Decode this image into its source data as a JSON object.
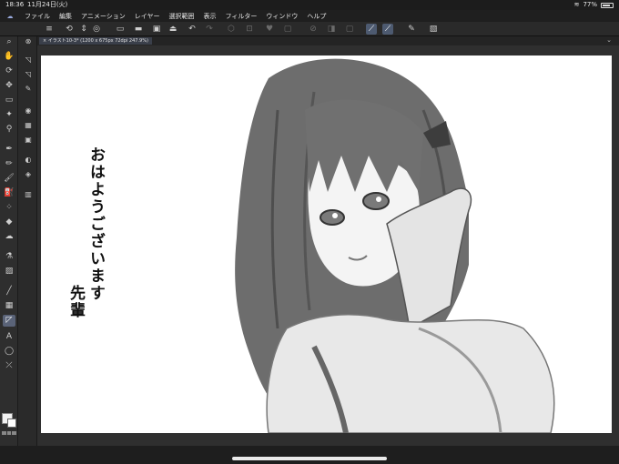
{
  "status": {
    "time": "18:36",
    "date": "11月24日(火)",
    "battery": "77%"
  },
  "menu": {
    "items": [
      "ファイル",
      "編集",
      "アニメーション",
      "レイヤー",
      "選択範囲",
      "表示",
      "フィルター",
      "ウィンドウ",
      "ヘルプ"
    ]
  },
  "document": {
    "tab_label": "× イラスト10-3* (1200 x 675px 72dpi 247.9%)"
  },
  "artwork": {
    "line1": "おはようございます",
    "line2": "先輩"
  },
  "colors": {
    "accent": "#5a6378",
    "canvas": "#ffffff",
    "chrome": "#2b2b2b"
  }
}
